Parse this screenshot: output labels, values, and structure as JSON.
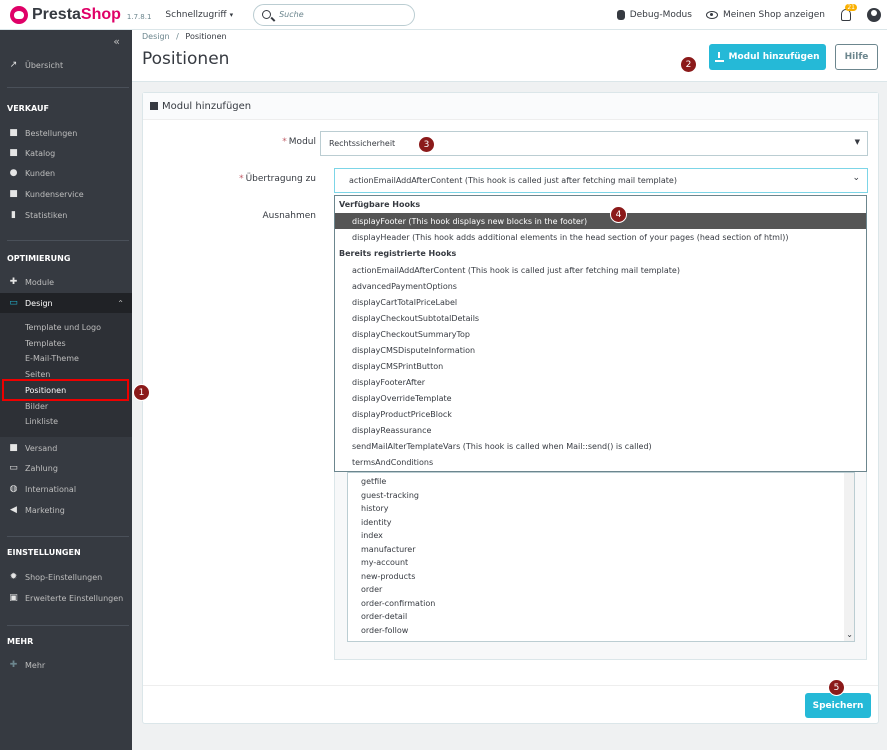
{
  "topbar": {
    "logo_text_a": "Presta",
    "logo_text_b": "Shop",
    "version": "1.7.8.1",
    "quick_access": "Schnellzugriff",
    "search_placeholder": "Suche",
    "debug": "Debug-Modus",
    "view_shop": "Meinen Shop anzeigen",
    "notifications_count": "21"
  },
  "sidebar": {
    "overview": "Übersicht",
    "sections": {
      "sales": "VERKAUF",
      "optimize": "OPTIMIERUNG",
      "settings": "EINSTELLUNGEN",
      "more": "MEHR"
    },
    "sales_items": [
      "Bestellungen",
      "Katalog",
      "Kunden",
      "Kundenservice",
      "Statistiken"
    ],
    "optimize_items": [
      "Module",
      "Design"
    ],
    "design_sub": [
      "Template und Logo",
      "Templates",
      "E-Mail-Theme",
      "Seiten",
      "Positionen",
      "Bilder",
      "Linkliste"
    ],
    "after_design": [
      "Versand",
      "Zahlung",
      "International",
      "Marketing"
    ],
    "settings_items": [
      "Shop-Einstellungen",
      "Erweiterte Einstellungen"
    ],
    "more_items": [
      "Mehr"
    ]
  },
  "header": {
    "breadcrumb_parent": "Design",
    "breadcrumb_sep": "/",
    "breadcrumb_current": "Positionen",
    "title": "Positionen",
    "add_module": "Modul hinzufügen",
    "help": "Hilfe"
  },
  "panel": {
    "title": "Modul hinzufügen",
    "label_module": "Modul",
    "label_hook": "Übertragung zu",
    "label_exceptions": "Ausnahmen",
    "module_value": "Rechtssicherheit",
    "hook_value": "actionEmailAddAfterContent (This hook is called just after fetching mail template)",
    "save": "Speichern"
  },
  "dropdown": {
    "group_available": "Verfügbare Hooks",
    "available": [
      "displayFooter (This hook displays new blocks in the footer)",
      "displayHeader (This hook adds additional elements in the head section of your pages (head section of html))"
    ],
    "group_registered": "Bereits registrierte Hooks",
    "registered": [
      "actionEmailAddAfterContent (This hook is called just after fetching mail template)",
      "advancedPaymentOptions",
      "displayCartTotalPriceLabel",
      "displayCheckoutSubtotalDetails",
      "displayCheckoutSummaryTop",
      "displayCMSDisputeInformation",
      "displayCMSPrintButton",
      "displayFooterAfter",
      "displayOverrideTemplate",
      "displayProductPriceBlock",
      "displayReassurance",
      "sendMailAlterTemplateVars (This hook is called when Mail::send() is called)",
      "termsAndConditions"
    ]
  },
  "exceptions": [
    "getfile",
    "guest-tracking",
    "history",
    "identity",
    "index",
    "manufacturer",
    "my-account",
    "new-products",
    "order",
    "order-confirmation",
    "order-detail",
    "order-follow"
  ],
  "callouts": [
    "1",
    "2",
    "3",
    "4",
    "5"
  ],
  "colors": {
    "accent": "#25b9d7",
    "brand": "#df0067",
    "sidebar": "#363a41"
  }
}
